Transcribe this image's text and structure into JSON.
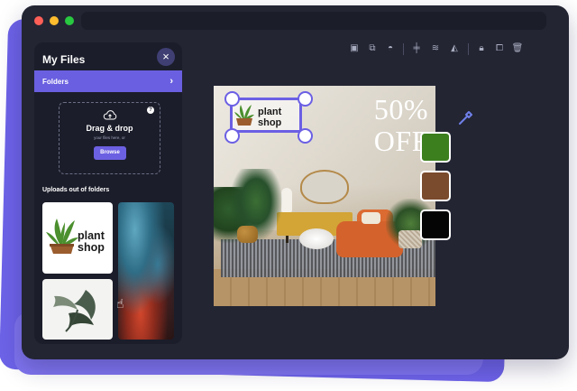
{
  "sidebar": {
    "title": "My Files",
    "close_icon": "×",
    "folders": {
      "label": "Folders",
      "chevron": "›"
    },
    "dropzone": {
      "title": "Drag & drop",
      "subtitle": "your files here, or",
      "button": "Browse",
      "help_icon": "?"
    },
    "uploads_title": "Uploads out of folders"
  },
  "canvas": {
    "promo_line1": "50%",
    "promo_line2": "OFF",
    "logo": {
      "line1": "plant",
      "line2": "shop"
    }
  },
  "thumb_logo": {
    "line1": "plant",
    "line2": "shop"
  },
  "palette": {
    "swatches": [
      "#3c7f1e",
      "#7a4b2d",
      "#050505"
    ]
  }
}
